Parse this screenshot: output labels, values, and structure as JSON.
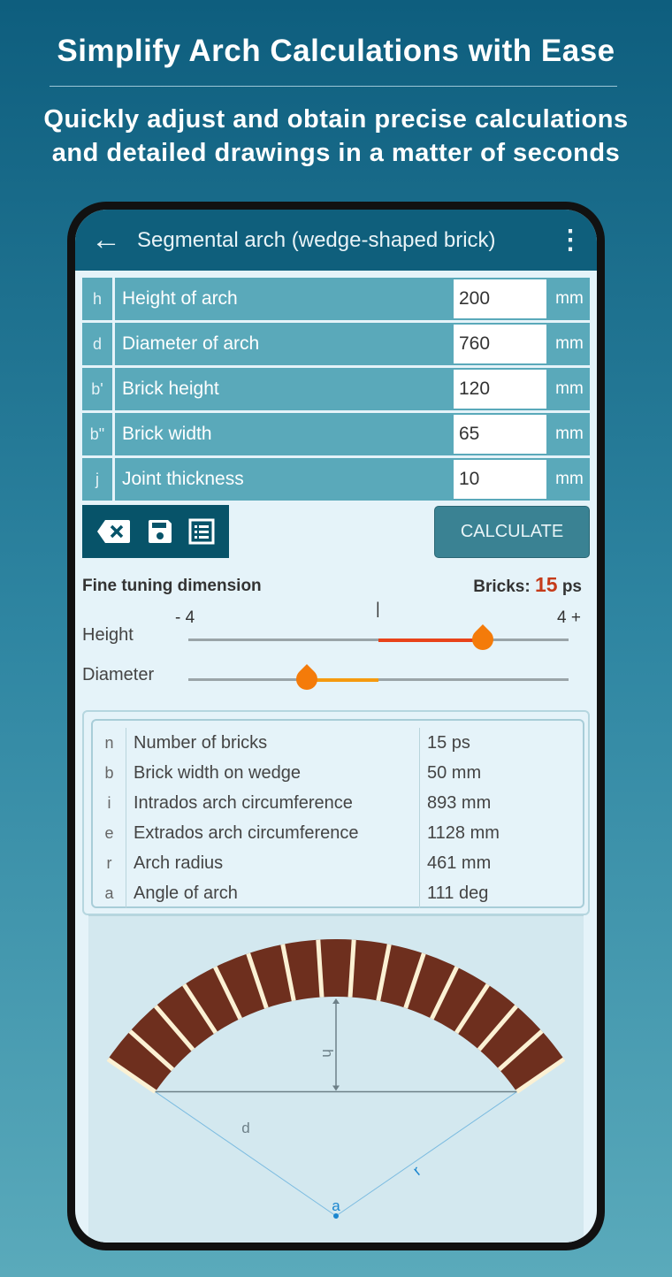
{
  "promo": {
    "headline": "Simplify Arch Calculations with Ease",
    "subline1": "Quickly adjust and obtain precise calculations",
    "subline2": "and detailed drawings in a matter of seconds"
  },
  "appbar": {
    "back_icon": "arrow-left-icon",
    "title": "Segmental arch (wedge-shaped brick)",
    "menu_icon": "more-vertical-icon"
  },
  "inputs": [
    {
      "symbol": "h",
      "label": "Height of arch",
      "value": "200",
      "unit": "mm"
    },
    {
      "symbol": "d",
      "label": "Diameter of arch",
      "value": "760",
      "unit": "mm"
    },
    {
      "symbol": "b'",
      "label": "Brick height",
      "value": "120",
      "unit": "mm"
    },
    {
      "symbol": "b\"",
      "label": "Brick width",
      "value": "65",
      "unit": "mm"
    },
    {
      "symbol": "j",
      "label": "Joint thickness",
      "value": "10",
      "unit": "mm"
    }
  ],
  "toolbar": {
    "clear_icon": "backspace-x-icon",
    "save_icon": "floppy-disk-icon",
    "list_icon": "list-icon",
    "calculate_label": "CALCULATE"
  },
  "fine_tuning": {
    "title": "Fine tuning dimension",
    "bricks_label": "Bricks:",
    "bricks_value": "15",
    "bricks_unit": "ps",
    "min_label": "- 4",
    "max_label": "4 +",
    "center_mark": "|",
    "sliders": [
      {
        "label": "Height",
        "value": 2.2,
        "min": -4,
        "max": 4,
        "color": "#e8431a"
      },
      {
        "label": "Diameter",
        "value": -1.5,
        "min": -4,
        "max": 4,
        "color": "#f59a0f"
      }
    ]
  },
  "results": [
    {
      "symbol": "n",
      "label": "Number of bricks",
      "value": "15 ps"
    },
    {
      "symbol": "b",
      "label": "Brick width on wedge",
      "value": "50 mm"
    },
    {
      "symbol": "i",
      "label": "Intrados arch circumference",
      "value": "893 mm"
    },
    {
      "symbol": "e",
      "label": "Extrados arch circumference",
      "value": "1128 mm"
    },
    {
      "symbol": "r",
      "label": "Arch radius",
      "value": "461 mm"
    },
    {
      "symbol": "a",
      "label": "Angle of arch",
      "value": "111 deg"
    }
  ],
  "drawing": {
    "brick_count": 15,
    "angle_deg": 111,
    "labels": {
      "h": "h",
      "d": "d",
      "r": "r",
      "a": "a"
    },
    "brick_color": "#6e2f1e",
    "joint_color": "#fbf1d4"
  }
}
